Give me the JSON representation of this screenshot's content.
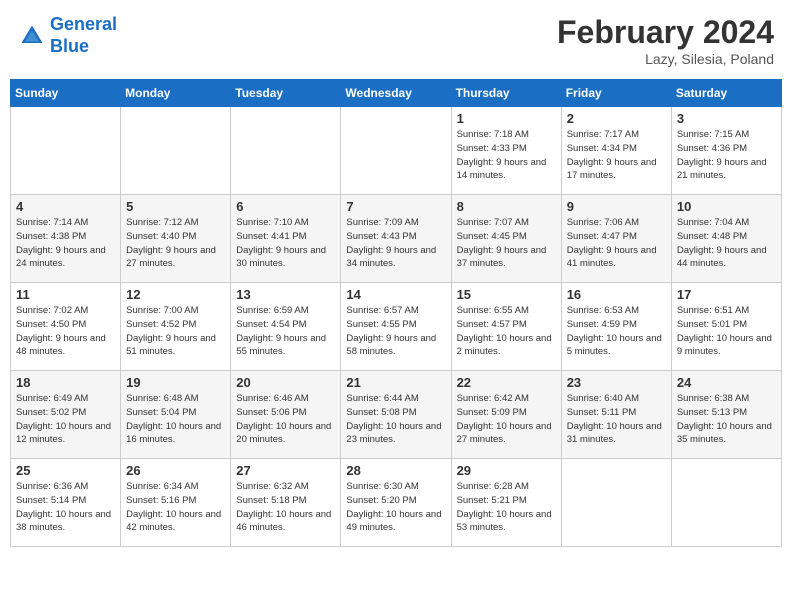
{
  "header": {
    "logo_line1": "General",
    "logo_line2": "Blue",
    "month": "February 2024",
    "location": "Lazy, Silesia, Poland"
  },
  "weekdays": [
    "Sunday",
    "Monday",
    "Tuesday",
    "Wednesday",
    "Thursday",
    "Friday",
    "Saturday"
  ],
  "weeks": [
    [
      {
        "day": "",
        "info": ""
      },
      {
        "day": "",
        "info": ""
      },
      {
        "day": "",
        "info": ""
      },
      {
        "day": "",
        "info": ""
      },
      {
        "day": "1",
        "info": "Sunrise: 7:18 AM\nSunset: 4:33 PM\nDaylight: 9 hours\nand 14 minutes."
      },
      {
        "day": "2",
        "info": "Sunrise: 7:17 AM\nSunset: 4:34 PM\nDaylight: 9 hours\nand 17 minutes."
      },
      {
        "day": "3",
        "info": "Sunrise: 7:15 AM\nSunset: 4:36 PM\nDaylight: 9 hours\nand 21 minutes."
      }
    ],
    [
      {
        "day": "4",
        "info": "Sunrise: 7:14 AM\nSunset: 4:38 PM\nDaylight: 9 hours\nand 24 minutes."
      },
      {
        "day": "5",
        "info": "Sunrise: 7:12 AM\nSunset: 4:40 PM\nDaylight: 9 hours\nand 27 minutes."
      },
      {
        "day": "6",
        "info": "Sunrise: 7:10 AM\nSunset: 4:41 PM\nDaylight: 9 hours\nand 30 minutes."
      },
      {
        "day": "7",
        "info": "Sunrise: 7:09 AM\nSunset: 4:43 PM\nDaylight: 9 hours\nand 34 minutes."
      },
      {
        "day": "8",
        "info": "Sunrise: 7:07 AM\nSunset: 4:45 PM\nDaylight: 9 hours\nand 37 minutes."
      },
      {
        "day": "9",
        "info": "Sunrise: 7:06 AM\nSunset: 4:47 PM\nDaylight: 9 hours\nand 41 minutes."
      },
      {
        "day": "10",
        "info": "Sunrise: 7:04 AM\nSunset: 4:48 PM\nDaylight: 9 hours\nand 44 minutes."
      }
    ],
    [
      {
        "day": "11",
        "info": "Sunrise: 7:02 AM\nSunset: 4:50 PM\nDaylight: 9 hours\nand 48 minutes."
      },
      {
        "day": "12",
        "info": "Sunrise: 7:00 AM\nSunset: 4:52 PM\nDaylight: 9 hours\nand 51 minutes."
      },
      {
        "day": "13",
        "info": "Sunrise: 6:59 AM\nSunset: 4:54 PM\nDaylight: 9 hours\nand 55 minutes."
      },
      {
        "day": "14",
        "info": "Sunrise: 6:57 AM\nSunset: 4:55 PM\nDaylight: 9 hours\nand 58 minutes."
      },
      {
        "day": "15",
        "info": "Sunrise: 6:55 AM\nSunset: 4:57 PM\nDaylight: 10 hours\nand 2 minutes."
      },
      {
        "day": "16",
        "info": "Sunrise: 6:53 AM\nSunset: 4:59 PM\nDaylight: 10 hours\nand 5 minutes."
      },
      {
        "day": "17",
        "info": "Sunrise: 6:51 AM\nSunset: 5:01 PM\nDaylight: 10 hours\nand 9 minutes."
      }
    ],
    [
      {
        "day": "18",
        "info": "Sunrise: 6:49 AM\nSunset: 5:02 PM\nDaylight: 10 hours\nand 12 minutes."
      },
      {
        "day": "19",
        "info": "Sunrise: 6:48 AM\nSunset: 5:04 PM\nDaylight: 10 hours\nand 16 minutes."
      },
      {
        "day": "20",
        "info": "Sunrise: 6:46 AM\nSunset: 5:06 PM\nDaylight: 10 hours\nand 20 minutes."
      },
      {
        "day": "21",
        "info": "Sunrise: 6:44 AM\nSunset: 5:08 PM\nDaylight: 10 hours\nand 23 minutes."
      },
      {
        "day": "22",
        "info": "Sunrise: 6:42 AM\nSunset: 5:09 PM\nDaylight: 10 hours\nand 27 minutes."
      },
      {
        "day": "23",
        "info": "Sunrise: 6:40 AM\nSunset: 5:11 PM\nDaylight: 10 hours\nand 31 minutes."
      },
      {
        "day": "24",
        "info": "Sunrise: 6:38 AM\nSunset: 5:13 PM\nDaylight: 10 hours\nand 35 minutes."
      }
    ],
    [
      {
        "day": "25",
        "info": "Sunrise: 6:36 AM\nSunset: 5:14 PM\nDaylight: 10 hours\nand 38 minutes."
      },
      {
        "day": "26",
        "info": "Sunrise: 6:34 AM\nSunset: 5:16 PM\nDaylight: 10 hours\nand 42 minutes."
      },
      {
        "day": "27",
        "info": "Sunrise: 6:32 AM\nSunset: 5:18 PM\nDaylight: 10 hours\nand 46 minutes."
      },
      {
        "day": "28",
        "info": "Sunrise: 6:30 AM\nSunset: 5:20 PM\nDaylight: 10 hours\nand 49 minutes."
      },
      {
        "day": "29",
        "info": "Sunrise: 6:28 AM\nSunset: 5:21 PM\nDaylight: 10 hours\nand 53 minutes."
      },
      {
        "day": "",
        "info": ""
      },
      {
        "day": "",
        "info": ""
      }
    ]
  ]
}
